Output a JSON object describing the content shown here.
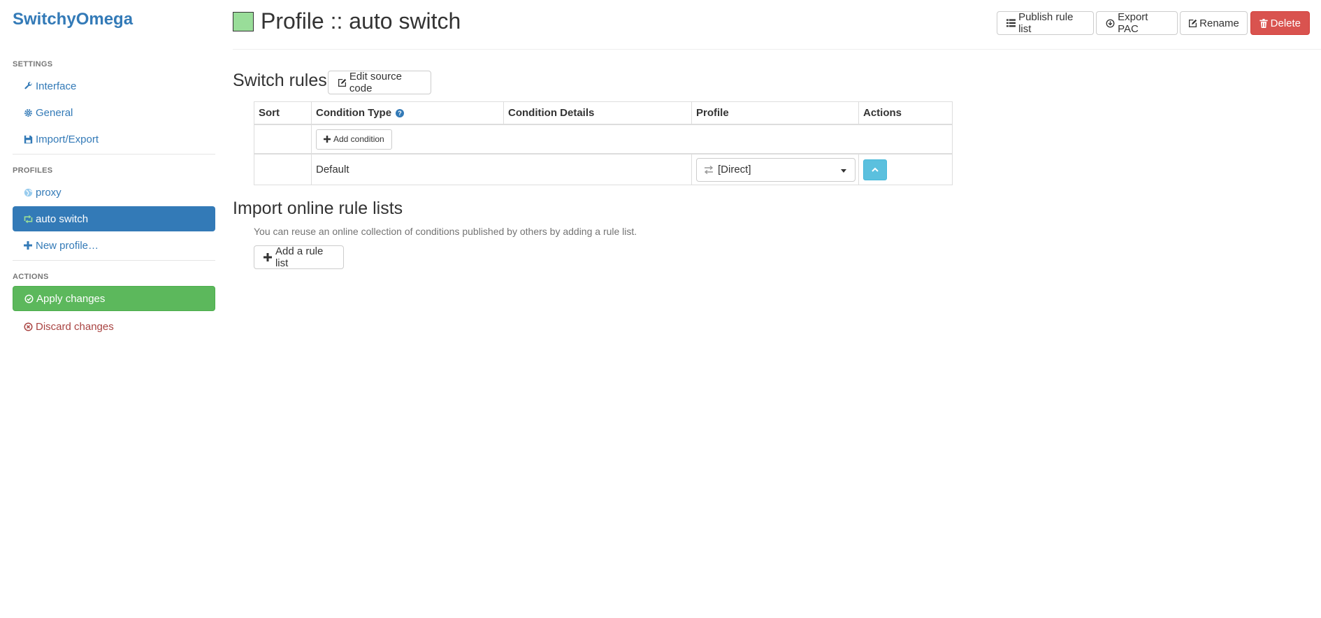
{
  "app": {
    "brand": "SwitchyOmega"
  },
  "sidebar": {
    "settings_header": "SETTINGS",
    "settings_items": [
      {
        "label": "Interface",
        "icon": "wrench-icon"
      },
      {
        "label": "General",
        "icon": "gear-icon"
      },
      {
        "label": "Import/Export",
        "icon": "floppy-icon"
      }
    ],
    "profiles_header": "PROFILES",
    "profile_items": [
      {
        "label": "proxy",
        "icon": "globe-icon"
      },
      {
        "label": "auto switch",
        "icon": "retweet-icon",
        "active": true
      },
      {
        "label": "New profile…",
        "icon": "plus-icon"
      }
    ],
    "actions_header": "ACTIONS",
    "apply_label": "Apply changes",
    "discard_label": "Discard changes"
  },
  "header": {
    "title": "Profile :: auto switch",
    "profile_color": "#99dd99",
    "buttons": {
      "publish": "Publish rule list",
      "export": "Export PAC",
      "rename": "Rename",
      "delete": "Delete"
    }
  },
  "switch_rules": {
    "title": "Switch rules",
    "edit_source_label": "Edit source code",
    "columns": [
      "Sort",
      "Condition Type",
      "Condition Details",
      "Profile",
      "Actions"
    ],
    "add_condition_label": "Add condition",
    "default_row": {
      "label": "Default",
      "profile": "[Direct]"
    }
  },
  "import_rules": {
    "title": "Import online rule lists",
    "help": "You can reuse an online collection of conditions published by others by adding a rule list.",
    "add_label": "Add a rule list"
  },
  "colors": {
    "primary": "#337ab7",
    "success": "#5cb85c",
    "danger": "#d9534f",
    "info": "#5bc0de"
  }
}
